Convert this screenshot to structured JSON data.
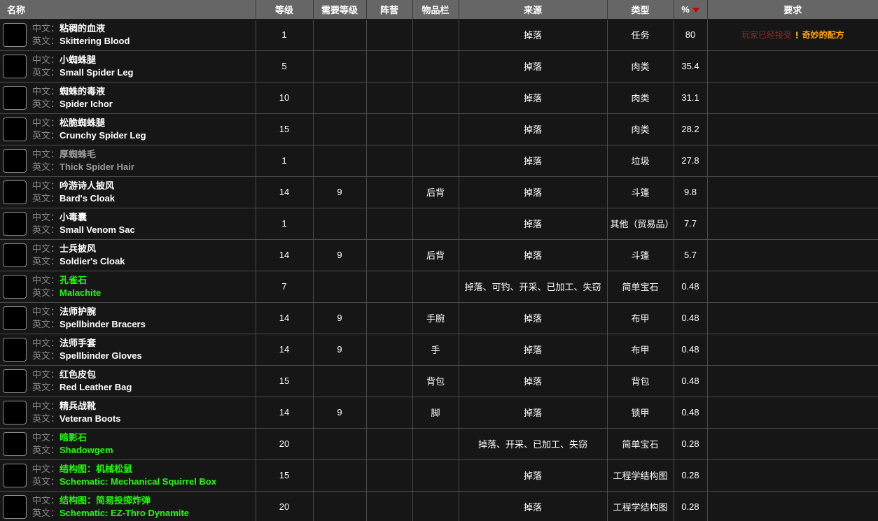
{
  "table": {
    "columns": [
      {
        "id": "name",
        "label": "名称",
        "align": "left",
        "sorted": false
      },
      {
        "id": "level",
        "label": "等级",
        "align": "center",
        "sorted": false
      },
      {
        "id": "req_level",
        "label": "需要等级",
        "align": "center",
        "sorted": false
      },
      {
        "id": "faction",
        "label": "阵营",
        "align": "center",
        "sorted": false
      },
      {
        "id": "slot",
        "label": "物品栏",
        "align": "center",
        "sorted": false
      },
      {
        "id": "source",
        "label": "来源",
        "align": "center",
        "sorted": false
      },
      {
        "id": "type",
        "label": "类型",
        "align": "center",
        "sorted": false
      },
      {
        "id": "percent",
        "label": "%",
        "align": "center",
        "sorted": true,
        "sort_direction": "desc"
      },
      {
        "id": "require",
        "label": "要求",
        "align": "center",
        "sorted": false
      }
    ],
    "name_labels": {
      "zh": "中文：",
      "en": "英文："
    },
    "colors": {
      "header_bg": "#666666",
      "row_bg": "#161616",
      "border": "#4a4a4a",
      "quality_common": "#ffffff",
      "quality_poor": "#9d9d9d",
      "quality_uncommon": "#1eff00",
      "sort_arrow": "#cc0000",
      "requirement_prefix": "#8c2b2b",
      "requirement_quest": "#ffa500",
      "quest_icon": "#ffd100"
    },
    "rows": [
      {
        "icon": "skittering-blood-icon",
        "icon_colors": [
          "#1d3d11",
          "#7bd62a",
          "#c2f06a"
        ],
        "name_zh": "粘稠的血液",
        "name_en": "Skittering Blood",
        "quality": "common",
        "level": "1",
        "req_level": "",
        "faction": "",
        "slot": "",
        "source": "掉落",
        "type": "任务",
        "percent": "80",
        "require_prefix": "玩家已经接受",
        "require_icon": "quest-exclamation-icon",
        "require_quest": "奇妙的配方"
      },
      {
        "icon": "small-spider-leg-icon",
        "icon_colors": [
          "#2a1038",
          "#6b2c8f",
          "#3f8f3a"
        ],
        "name_zh": "小蜘蛛腿",
        "name_en": "Small Spider Leg",
        "quality": "common",
        "level": "5",
        "req_level": "",
        "faction": "",
        "slot": "",
        "source": "掉落",
        "type": "肉类",
        "percent": "35.4",
        "require_prefix": "",
        "require_icon": "",
        "require_quest": ""
      },
      {
        "icon": "spider-ichor-icon",
        "icon_colors": [
          "#10290a",
          "#5ec41f",
          "#b8f07a"
        ],
        "name_zh": "蜘蛛的毒液",
        "name_en": "Spider Ichor",
        "quality": "common",
        "level": "10",
        "req_level": "",
        "faction": "",
        "slot": "",
        "source": "掉落",
        "type": "肉类",
        "percent": "31.1",
        "require_prefix": "",
        "require_icon": "",
        "require_quest": ""
      },
      {
        "icon": "crunchy-spider-leg-icon",
        "icon_colors": [
          "#241118",
          "#8a5a1f",
          "#7a3f8f"
        ],
        "name_zh": "松脆蜘蛛腿",
        "name_en": "Crunchy Spider Leg",
        "quality": "common",
        "level": "15",
        "req_level": "",
        "faction": "",
        "slot": "",
        "source": "掉落",
        "type": "肉类",
        "percent": "28.2",
        "require_prefix": "",
        "require_icon": "",
        "require_quest": ""
      },
      {
        "icon": "thick-spider-hair-icon",
        "icon_colors": [
          "#271338",
          "#6a2d91",
          "#2f6b2a"
        ],
        "name_zh": "厚蜘蛛毛",
        "name_en": "Thick Spider Hair",
        "quality": "poor",
        "level": "1",
        "req_level": "",
        "faction": "",
        "slot": "",
        "source": "掉落",
        "type": "垃圾",
        "percent": "27.8",
        "require_prefix": "",
        "require_icon": "",
        "require_quest": ""
      },
      {
        "icon": "bards-cloak-icon",
        "icon_colors": [
          "#2b0705",
          "#a3201a",
          "#d94b3a"
        ],
        "name_zh": "吟游诗人披风",
        "name_en": "Bard's Cloak",
        "quality": "common",
        "level": "14",
        "req_level": "9",
        "faction": "",
        "slot": "后背",
        "source": "掉落",
        "type": "斗篷",
        "percent": "9.8",
        "require_prefix": "",
        "require_icon": "",
        "require_quest": ""
      },
      {
        "icon": "small-venom-sac-icon",
        "icon_colors": [
          "#2a2414",
          "#9a8a3c",
          "#d6c06a"
        ],
        "name_zh": "小毒囊",
        "name_en": "Small Venom Sac",
        "quality": "common",
        "level": "1",
        "req_level": "",
        "faction": "",
        "slot": "",
        "source": "掉落",
        "type": "其他（贸易品）",
        "percent": "7.7",
        "require_prefix": "",
        "require_icon": "",
        "require_quest": ""
      },
      {
        "icon": "soldiers-cloak-icon",
        "icon_colors": [
          "#071f10",
          "#1c6a33",
          "#3fa05a"
        ],
        "name_zh": "士兵披风",
        "name_en": "Soldier's Cloak",
        "quality": "common",
        "level": "14",
        "req_level": "9",
        "faction": "",
        "slot": "后背",
        "source": "掉落",
        "type": "斗篷",
        "percent": "5.7",
        "require_prefix": "",
        "require_icon": "",
        "require_quest": ""
      },
      {
        "icon": "malachite-icon",
        "icon_colors": [
          "#08220c",
          "#2fbf3a",
          "#8ef27a"
        ],
        "name_zh": "孔雀石",
        "name_en": "Malachite",
        "quality": "uncommon",
        "level": "7",
        "req_level": "",
        "faction": "",
        "slot": "",
        "source": "掉落、可钓、开采、已加工、失窃",
        "type": "简单宝石",
        "percent": "0.48",
        "require_prefix": "",
        "require_icon": "",
        "require_quest": ""
      },
      {
        "icon": "spellbinder-bracers-icon",
        "icon_colors": [
          "#1b2014",
          "#5c6b45",
          "#9aa87d"
        ],
        "name_zh": "法师护腕",
        "name_en": "Spellbinder Bracers",
        "quality": "common",
        "level": "14",
        "req_level": "9",
        "faction": "",
        "slot": "手腕",
        "source": "掉落",
        "type": "布甲",
        "percent": "0.48",
        "require_prefix": "",
        "require_icon": "",
        "require_quest": ""
      },
      {
        "icon": "spellbinder-gloves-icon",
        "icon_colors": [
          "#231a12",
          "#6e563c",
          "#b09070"
        ],
        "name_zh": "法师手套",
        "name_en": "Spellbinder Gloves",
        "quality": "common",
        "level": "14",
        "req_level": "9",
        "faction": "",
        "slot": "手",
        "source": "掉落",
        "type": "布甲",
        "percent": "0.48",
        "require_prefix": "",
        "require_icon": "",
        "require_quest": ""
      },
      {
        "icon": "red-leather-bag-icon",
        "icon_colors": [
          "#2b0e12",
          "#9c2e38",
          "#cf5a62"
        ],
        "name_zh": "红色皮包",
        "name_en": "Red Leather Bag",
        "quality": "common",
        "level": "15",
        "req_level": "",
        "faction": "",
        "slot": "背包",
        "source": "掉落",
        "type": "背包",
        "percent": "0.48",
        "require_prefix": "",
        "require_icon": "",
        "require_quest": ""
      },
      {
        "icon": "veteran-boots-icon",
        "icon_colors": [
          "#1a1008",
          "#8a5a2a",
          "#c78d4e"
        ],
        "name_zh": "精兵战靴",
        "name_en": "Veteran Boots",
        "quality": "common",
        "level": "14",
        "req_level": "9",
        "faction": "",
        "slot": "脚",
        "source": "掉落",
        "type": "锁甲",
        "percent": "0.48",
        "require_prefix": "",
        "require_icon": "",
        "require_quest": ""
      },
      {
        "icon": "shadowgem-icon",
        "icon_colors": [
          "#2d0a33",
          "#b42ec4",
          "#ef82f5"
        ],
        "name_zh": "暗影石",
        "name_en": "Shadowgem",
        "quality": "uncommon",
        "level": "20",
        "req_level": "",
        "faction": "",
        "slot": "",
        "source": "掉落、开采、已加工、失窃",
        "type": "简单宝石",
        "percent": "0.28",
        "require_prefix": "",
        "require_icon": "",
        "require_quest": ""
      },
      {
        "icon": "schematic-icon",
        "icon_colors": [
          "#303a12",
          "#9fb03a",
          "#3a8fc4"
        ],
        "name_zh": "结构图：机械松鼠",
        "name_en": "Schematic: Mechanical Squirrel Box",
        "quality": "uncommon",
        "level": "15",
        "req_level": "",
        "faction": "",
        "slot": "",
        "source": "掉落",
        "type": "工程学结构图",
        "percent": "0.28",
        "require_prefix": "",
        "require_icon": "",
        "require_quest": ""
      },
      {
        "icon": "schematic-icon",
        "icon_colors": [
          "#303a12",
          "#9fb03a",
          "#3a8fc4"
        ],
        "name_zh": "结构图：简易投掷炸弹",
        "name_en": "Schematic: EZ-Thro Dynamite",
        "quality": "uncommon",
        "level": "20",
        "req_level": "",
        "faction": "",
        "slot": "",
        "source": "掉落",
        "type": "工程学结构图",
        "percent": "0.28",
        "require_prefix": "",
        "require_icon": "",
        "require_quest": ""
      }
    ]
  }
}
